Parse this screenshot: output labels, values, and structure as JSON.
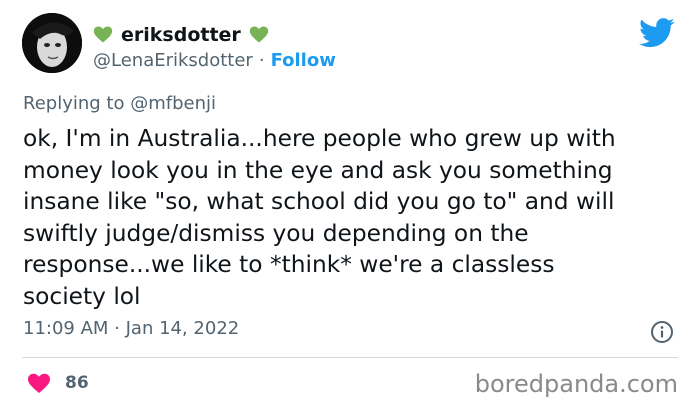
{
  "tweet": {
    "display_name": "eriksdotter",
    "handle": "@LenaEriksdotter",
    "separator": "·",
    "follow_label": "Follow",
    "replying_prefix": "Replying to",
    "replying_to": "@mfbenji",
    "text": "ok, I'm in Australia...here people who grew up with\nmoney look you in the eye and ask you something\ninsane like \"so, what school did you go to\" and will\nswiftly judge/dismiss you depending on the\nresponse...we like to *think* we're a classless\nsociety lol",
    "timestamp": "11:09 AM · Jan 14, 2022",
    "like_count": "86"
  },
  "watermark": "boredpanda.com",
  "icons": {
    "name_decoration": "green-heart-icon",
    "brand": "twitter-bird-icon",
    "info": "info-icon",
    "like": "heart-icon"
  },
  "colors": {
    "accent": "#1d9bf0",
    "secondary_text": "#536471",
    "green_heart": "#77b255",
    "like_heart": "#f91880"
  }
}
